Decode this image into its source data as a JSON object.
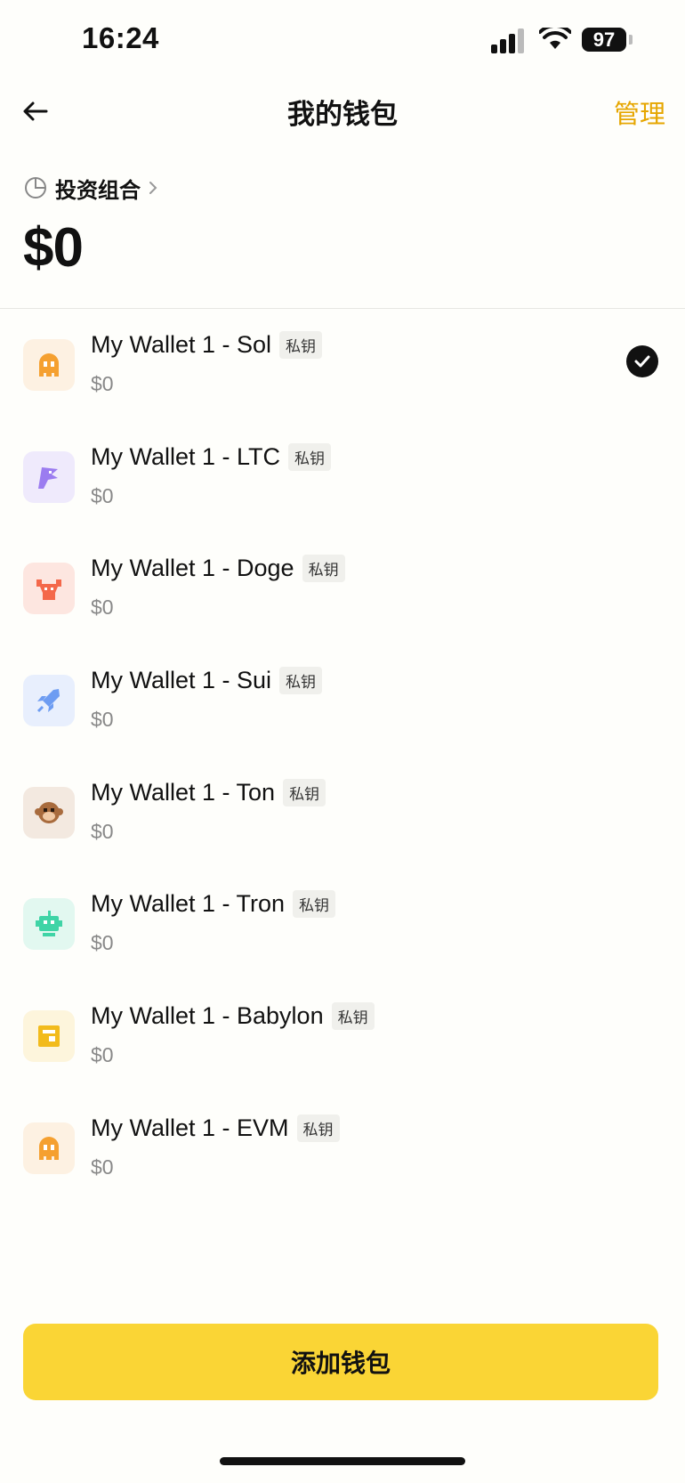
{
  "status_bar": {
    "time": "16:24",
    "battery": "97"
  },
  "nav": {
    "title": "我的钱包",
    "manage_label": "管理"
  },
  "portfolio": {
    "label": "投资组合",
    "total": "$0"
  },
  "wallets": [
    {
      "name": "My Wallet 1 - Sol",
      "tag": "私钥",
      "balance": "$0",
      "icon": "orange-ghost-icon",
      "icon_color": "#f5a030",
      "icon_bg": "#fdf1e2",
      "selected": true
    },
    {
      "name": "My Wallet 1 - LTC",
      "tag": "私钥",
      "balance": "$0",
      "icon": "purple-bird-icon",
      "icon_color": "#9b7cf0",
      "icon_bg": "#efeafc",
      "selected": false
    },
    {
      "name": "My Wallet 1 - Doge",
      "tag": "私钥",
      "balance": "$0",
      "icon": "red-bull-icon",
      "icon_color": "#f4684a",
      "icon_bg": "#fde6e0",
      "selected": false
    },
    {
      "name": "My Wallet 1 - Sui",
      "tag": "私钥",
      "balance": "$0",
      "icon": "blue-rocket-icon",
      "icon_color": "#6d9cf2",
      "icon_bg": "#e8effd",
      "selected": false
    },
    {
      "name": "My Wallet 1 - Ton",
      "tag": "私钥",
      "balance": "$0",
      "icon": "brown-monkey-icon",
      "icon_color": "#a86b3d",
      "icon_bg": "#f3e9e0",
      "selected": false
    },
    {
      "name": "My Wallet 1 - Tron",
      "tag": "私钥",
      "balance": "$0",
      "icon": "green-robot-icon",
      "icon_color": "#3fd4a6",
      "icon_bg": "#e2f8f0",
      "selected": false
    },
    {
      "name": "My Wallet 1 - Babylon",
      "tag": "私钥",
      "balance": "$0",
      "icon": "yellow-wallet-icon",
      "icon_color": "#f2bb1c",
      "icon_bg": "#fdf5dc",
      "selected": false
    },
    {
      "name": "My Wallet 1 - EVM",
      "tag": "私钥",
      "balance": "$0",
      "icon": "orange-ghost-icon",
      "icon_color": "#f5a030",
      "icon_bg": "#fdf1e2",
      "selected": false
    }
  ],
  "add_button_label": "添加钱包",
  "colors": {
    "accent": "#e6a600",
    "button": "#fad535"
  }
}
